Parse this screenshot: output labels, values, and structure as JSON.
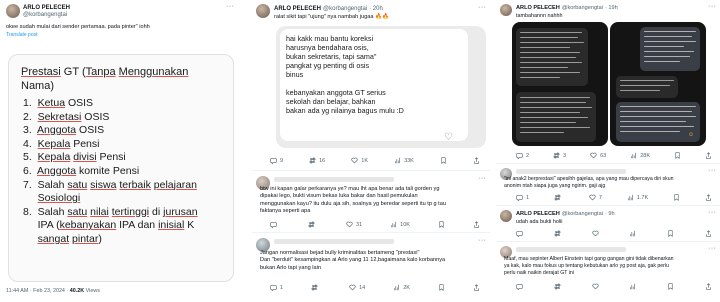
{
  "tweet1": {
    "author_name": "ARLO PELECEH",
    "handle": "@korbangengtai",
    "text": "okee sudah mulai dari sender pertamaa. pada pinter\" iohh",
    "translate": "Translate post",
    "image": {
      "title_plain": "Prestasi GT (Tanpa Menggunakan Nama)",
      "items": [
        "1. Ketua OSIS",
        "2. Sekretasi OSIS",
        "3. Anggota OSIS",
        "4. Kepala Pensi",
        "5. Kepala divisi Pensi",
        "6. Anggota komite Pensi",
        "7. Salah satu siswa terbaik pelajaran",
        "Sosiologi",
        "8. Salah satu nilai tertinggi di jurusan",
        "IPA (kebanyakan IPA dan inisial K",
        "sangat pintar)"
      ]
    },
    "meta_time": "11:44 AM · Feb 23, 2024 · ",
    "meta_views": "40.2K",
    "meta_views_label": " Views"
  },
  "tweet2": {
    "author_name": "ARLO PELECEH",
    "handle": "@korbangengtai",
    "time": "· 20h",
    "text": "ralat sikit tapi \"ujung\" nya nambah jugaa 🔥🔥",
    "image_lines": [
      "hai kakk mau bantu koreksi",
      "harusnya bendahara osis,",
      "bukan sekretaris, tapi sama\"",
      "pangkat yg penting di osis",
      "binus",
      "",
      "kebanyakan anggota GT serius",
      "sekolah dan belajar,  bahkan",
      "bakan ada yg nilainya bagus mulu :D"
    ],
    "replies": "9",
    "retweets": "16",
    "likes": "1K",
    "views": "33K"
  },
  "reply1": {
    "text_lines": [
      "btw ini kapan galar perkaranya ye? mau lht apa benar ada tali gorden yg",
      "dipakai lego, bukti visum bekas luka bakar dan hasil pemukulan",
      "menggunakan kayu? itu dulu aja sih, soalnya yg beredar seperti itu tp g tau",
      "faktanya seperti apa"
    ],
    "replies": "",
    "retweets": "",
    "likes": "31",
    "views": "10K"
  },
  "reply2": {
    "text_lines": [
      "Jangan normalisasi bejad bully kriminalitas bertameng \"prestasi\"",
      "Dan \"berduit\" kesampingkan ai Arlo yang 11 12,bagaimana kalo korbannya",
      "bukan Arlo tapi yang lain"
    ],
    "replies": "1",
    "retweets": "",
    "likes": "14",
    "views": "2K"
  },
  "tweet3": {
    "author_name": "ARLO PELECEH",
    "handle": "@korbangengtai",
    "time": "· 19h",
    "text": "tambahannn nahhh",
    "replies": "2",
    "retweets": "3",
    "likes": "63",
    "views": "28K"
  },
  "reply3": {
    "text_lines": [
      "\"ini anak2 berprestasi\" apesihh gajelas, apa yang mau dipercaya diri skun",
      "anonim ntah siapa juga yang ngirim. gaji ajg"
    ],
    "replies": "1",
    "retweets": "",
    "likes": "7",
    "views": "1.7K"
  },
  "tweet4": {
    "author_name": "ARLO PELECEH",
    "handle": "@korbangengtai",
    "time": "· 9h",
    "text": "udah ada bukti holii",
    "replies": "",
    "retweets": "",
    "likes": "",
    "views": ""
  },
  "reply4": {
    "text_lines": [
      "Maaf, mau sepinter Albert Einstein tapi gang gangan gini tidak dibenarkan",
      "ya kak, kalo mau fokus up tentang kebutukan arlo yg post aja, gak perlu",
      "perlu naik naikin derajat GT ini"
    ],
    "replies": "",
    "retweets": "",
    "likes": "",
    "views": ""
  },
  "colors": {
    "accent": "#1d9bf0",
    "muted": "#536471",
    "fire": "#f4900c",
    "underline": "#d9534f"
  }
}
